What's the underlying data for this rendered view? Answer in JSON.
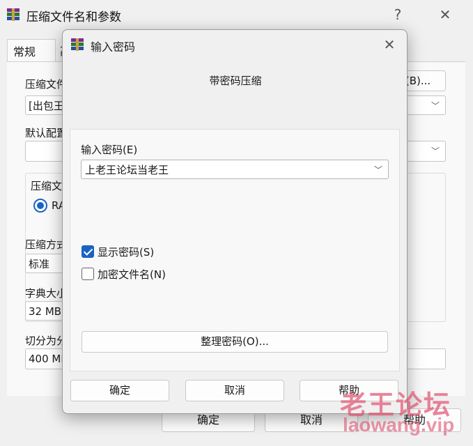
{
  "main_window": {
    "title": "压缩文件名和参数",
    "help_glyph": "?",
    "close_glyph": "✕",
    "tabs": [
      {
        "label": "常规"
      },
      {
        "label": "高"
      }
    ],
    "archive_name_label": "压缩文件",
    "archive_name_value": "[出包王",
    "browse_button_label": "(B)...",
    "default_profile_label": "默认配置",
    "archive_format_group_label": "压缩文",
    "format_option_label": "RA",
    "compression_method_label": "压缩方式",
    "compression_method_value": "标准",
    "dictionary_size_label": "字典大小",
    "dictionary_size_value": "32 MB",
    "split_label": "切分为分",
    "split_value": "400 MB",
    "ok_label": "确定",
    "cancel_label": "取消",
    "help_label": "帮助"
  },
  "dialog": {
    "title": "输入密码",
    "close_glyph": "✕",
    "heading": "带密码压缩",
    "password_label": "输入密码(E)",
    "password_value": "上老王论坛当老王",
    "show_password_label": "显示密码(S)",
    "show_password_checked": true,
    "encrypt_filenames_label": "加密文件名(N)",
    "encrypt_filenames_checked": false,
    "organize_button_label": "整理密码(O)...",
    "ok_label": "确定",
    "cancel_label": "取消",
    "help_label": "帮助"
  },
  "watermark": {
    "line1": "老王论坛",
    "line2": "laowang.vip",
    "color": "#e1506e"
  }
}
